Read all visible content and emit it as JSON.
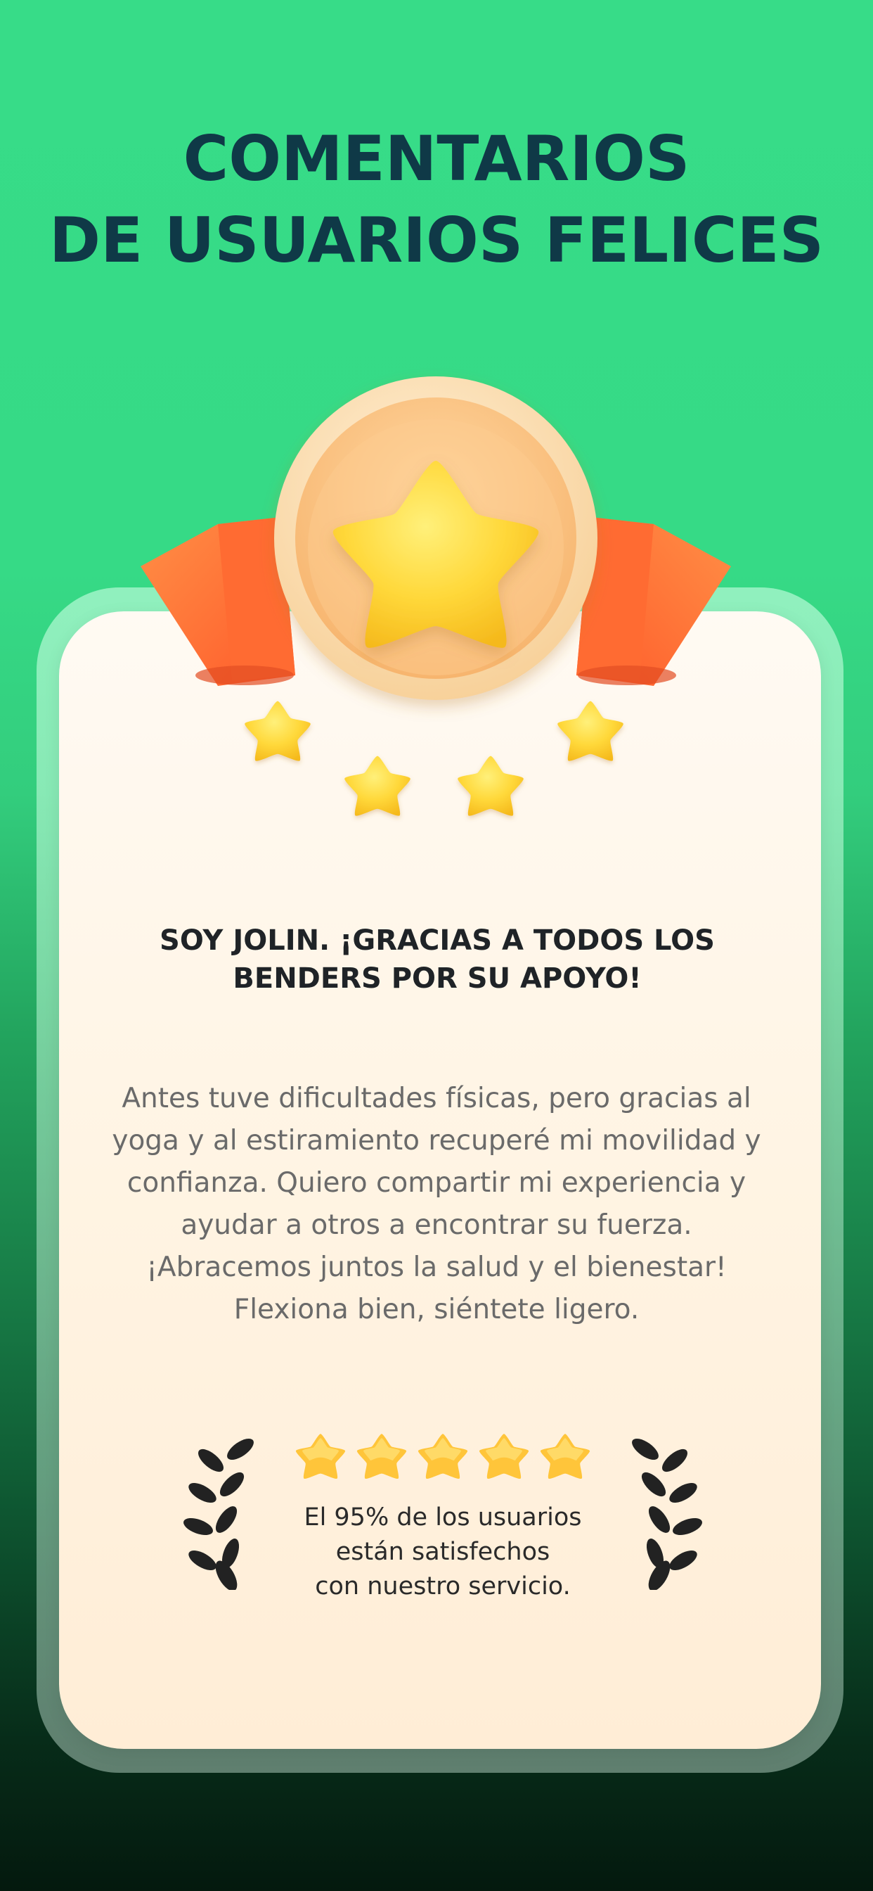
{
  "header": {
    "title_line1": "COMENTARIOS",
    "title_line2": "DE USUARIOS FELICES"
  },
  "card": {
    "heading_line1": "SOY JOLIN. ¡GRACIAS A TODOS LOS",
    "heading_line2": "BENDERS POR SU APOYO!",
    "body_lines": [
      "Antes tuve dificultades físicas, pero gracias al",
      "yoga y al estiramiento recuperé mi movilidad y",
      "confianza. Quiero compartir mi experiencia y",
      "ayudar a otros a encontrar su fuerza.",
      "¡Abracemos juntos la salud y el bienestar!",
      "Flexiona bien, siéntete ligero."
    ]
  },
  "rating": {
    "stars": 5,
    "max_stars": 5,
    "text_line1": "El 95% de los usuarios",
    "text_line2": "están satisfechos",
    "text_line3": "con nuestro servicio."
  },
  "icons": {
    "medal": "medal-star-icon",
    "small_star": "star-icon",
    "laurel": "laurel-icon"
  },
  "colors": {
    "title": "#0f3947",
    "accent_green": "#37dc88",
    "star_yellow": "#ffd53d",
    "ribbon_orange": "#ff7a3a",
    "medal_peach": "#fbd7a6"
  }
}
